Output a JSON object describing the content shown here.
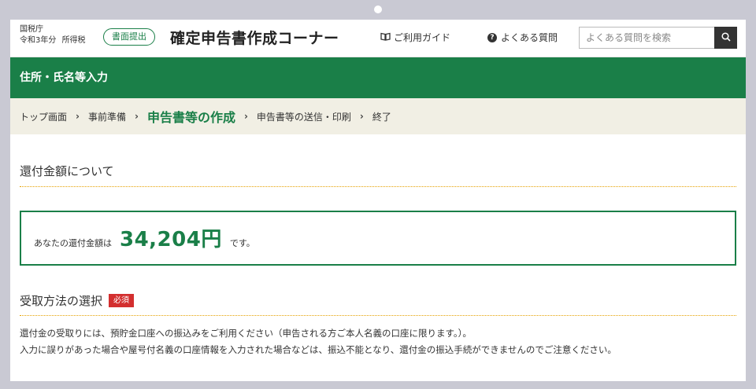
{
  "header": {
    "agency": "国税庁",
    "year": "令和3年分",
    "tax_type": "所得税",
    "submit_badge": "書面提出",
    "site_title": "確定申告書作成コーナー",
    "guide_link": "ご利用ガイド",
    "faq_link": "よくある質問",
    "search_placeholder": "よくある質問を検索",
    "search_icon": "search-icon",
    "guide_icon": "book-icon",
    "faq_icon": "question-circle-icon"
  },
  "section_title": "住所・氏名等入力",
  "breadcrumb": {
    "items": [
      "トップ画面",
      "事前準備",
      "申告書等の作成",
      "申告書等の送信・印刷",
      "終了"
    ],
    "current_index": 2
  },
  "refund": {
    "heading": "還付金額について",
    "prefix": "あなたの還付金額は",
    "amount": "34,204円",
    "suffix": "です。"
  },
  "receipt": {
    "heading": "受取方法の選択",
    "required_badge": "必須",
    "note_line1": "還付金の受取りには、預貯金口座への振込みをご利用ください（申告される方ご本人名義の口座に限ります。）。",
    "note_line2": "入力に誤りがあった場合や屋号付名義の口座情報を入力された場合などは、振込不能となり、還付金の振込手続ができませんのでご注意ください。"
  },
  "colors": {
    "brand_green": "#1a7f48",
    "breadcrumb_bg": "#f1efe4",
    "required_red": "#d32f2f",
    "divider_orange": "#e6a100"
  }
}
